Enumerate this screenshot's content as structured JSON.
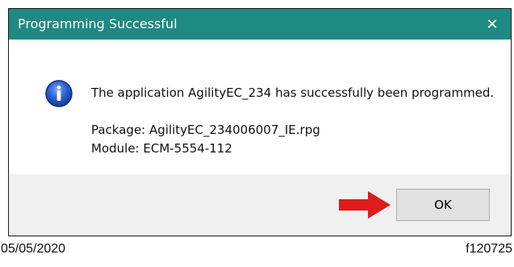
{
  "dialog": {
    "title": "Programming Successful",
    "close_glyph": "✕",
    "message": "The application AgilityEC_234 has successfully been programmed.",
    "package_line": "Package: AgilityEC_234006007_IE.rpg",
    "module_line": "Module: ECM-5554-112",
    "ok_label": "OK",
    "icon": "info-icon"
  },
  "annotation": {
    "arrow": "red-arrow-icon"
  },
  "caption": {
    "date": "05/05/2020",
    "figure_id": "f120725"
  },
  "colors": {
    "titlebar": "#1e8a82",
    "arrow": "#e01b1b",
    "footer": "#f0f0f0",
    "button": "#e1e1e1"
  }
}
